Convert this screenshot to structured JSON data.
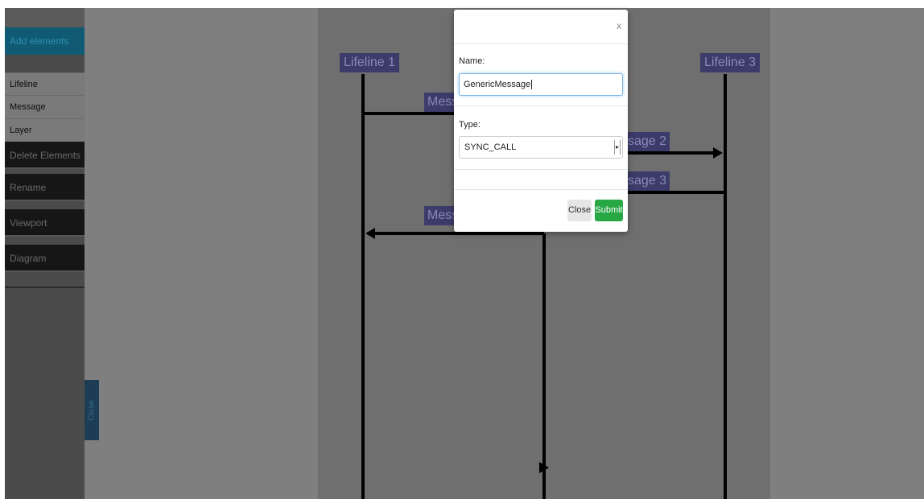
{
  "sidebar": {
    "sections": [
      {
        "label": "Add elements",
        "active": true
      },
      {
        "label": "Delete Elements",
        "active": false
      },
      {
        "label": "Rename",
        "active": false
      },
      {
        "label": "Viewport",
        "active": false
      },
      {
        "label": "Diagram",
        "active": false
      }
    ],
    "add_items": [
      "Lifeline",
      "Message",
      "Layer"
    ]
  },
  "close_tab": {
    "label": "Close"
  },
  "diagram": {
    "lifelines": [
      "Lifeline 1",
      "Lifeline 3"
    ],
    "message_labels": [
      "Mess",
      "sage 2",
      "sage 3",
      "Mess"
    ]
  },
  "modal": {
    "close_symbol": "x",
    "name_label": "Name:",
    "name_value": "GenericMessage",
    "type_label": "Type:",
    "type_value": "SYNC_CALL",
    "close_button": "Close",
    "submit_button": "Submit"
  },
  "colors": {
    "submit": "#28a745",
    "active_section": "#105a74",
    "lifeline_label_bg": "#3c3c6a"
  }
}
